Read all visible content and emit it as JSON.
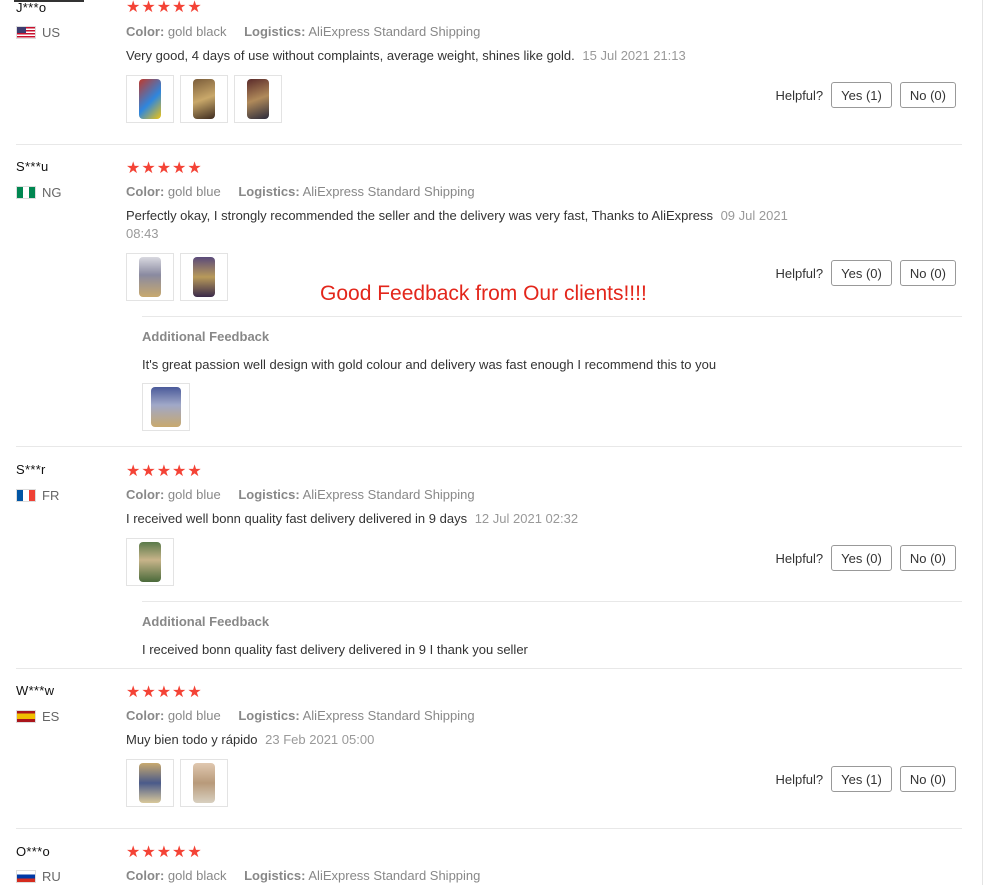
{
  "labels": {
    "color": "Color:",
    "logistics": "Logistics:",
    "helpful": "Helpful?",
    "additional": "Additional Feedback"
  },
  "stars": "★★★★★",
  "overlay_text": "Good Feedback from Our clients!!!!",
  "reviews": [
    {
      "user": "J***o",
      "country": "US",
      "color": "gold black",
      "logistics": "AliExpress Standard Shipping",
      "text": "Very good, 4 days of use without complaints, average weight, shines like gold.",
      "date": "15 Jul 2021 21:13",
      "yes": "Yes (1)",
      "no": "No (0)"
    },
    {
      "user": "S***u",
      "country": "NG",
      "color": "gold blue",
      "logistics": "AliExpress Standard Shipping",
      "text": "Perfectly okay, I strongly recommended the seller and the delivery was very fast, Thanks to AliExpress",
      "date": "09 Jul 2021",
      "date2": "08:43",
      "yes": "Yes (0)",
      "no": "No (0)",
      "additional": "It's great passion well design with gold colour and delivery was fast enough I recommend this to you"
    },
    {
      "user": "S***r",
      "country": "FR",
      "color": "gold blue",
      "logistics": "AliExpress Standard Shipping",
      "text": "I received well bonn quality fast delivery delivered in 9 days",
      "date": "12 Jul 2021 02:32",
      "yes": "Yes (0)",
      "no": "No (0)",
      "additional": "I received bonn quality fast delivery delivered in 9 I thank you seller"
    },
    {
      "user": "W***w",
      "country": "ES",
      "color": "gold blue",
      "logistics": "AliExpress Standard Shipping",
      "text": "Muy bien todo y rápido",
      "date": "23 Feb 2021 05:00",
      "yes": "Yes (1)",
      "no": "No (0)"
    },
    {
      "user": "O***o",
      "country": "RU",
      "color": "gold black",
      "logistics": "AliExpress Standard Shipping"
    }
  ]
}
